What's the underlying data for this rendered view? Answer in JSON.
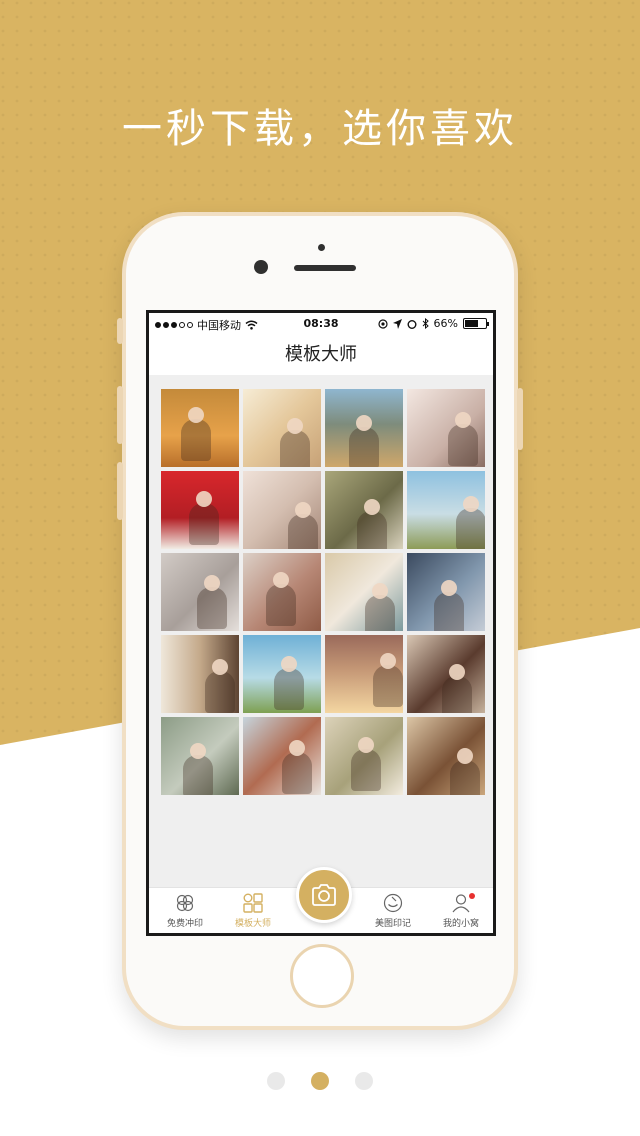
{
  "headline": "一秒下载，选你喜欢",
  "colors": {
    "brand_gold": "#d4b061",
    "background_gold": "#d9b462",
    "phone_rim": "#f1dfc4",
    "badge_red": "#e7302f"
  },
  "status_bar": {
    "carrier": "中国移动",
    "time": "08:38",
    "battery": "66%",
    "battery_level": 0.66,
    "icons": [
      "signal-dots",
      "wifi",
      "location",
      "alarm",
      "bluetooth",
      "battery"
    ]
  },
  "nav": {
    "title": "模板大师"
  },
  "photos": [
    {
      "name": "photo-maple-leaf",
      "bg": "linear-gradient(180deg,#c48a3a,#e7a24a 60%,#b86f2a)"
    },
    {
      "name": "photo-sunlight-hair",
      "bg": "linear-gradient(135deg,#f6ecd5,#e4c79a 50%,#c7a277)"
    },
    {
      "name": "photo-mountain-field",
      "bg": "linear-gradient(180deg,#8fb6cf,#7e8c7c 45%,#cfa76a)"
    },
    {
      "name": "photo-girl-flower",
      "bg": "linear-gradient(135deg,#f3e7e1,#c9b0a6 60%,#8a6d63)"
    },
    {
      "name": "photo-telephone-booth",
      "bg": "linear-gradient(180deg,#d8272c,#b31e24 60%,#f1ece4)"
    },
    {
      "name": "photo-girl-lying",
      "bg": "linear-gradient(135deg,#efe1d8,#d4beb0 50%,#a58777)"
    },
    {
      "name": "photo-grass-lying",
      "bg": "linear-gradient(135deg,#a9a67a,#6c6a48 55%,#d9d2bd)"
    },
    {
      "name": "photo-jump-field",
      "bg": "linear-gradient(180deg,#8ec1e0,#c9dde4 55%,#8d9b57)"
    },
    {
      "name": "photo-veil",
      "bg": "linear-gradient(135deg,#d2cbc6,#a89f9a 55%,#e5dfdb)"
    },
    {
      "name": "photo-flower-crown",
      "bg": "linear-gradient(135deg,#dcd0c7,#b78775 55%,#8f5b46)"
    },
    {
      "name": "photo-fan",
      "bg": "linear-gradient(135deg,#d9c9a8,#f0e8dc 50%,#7c9a9d)"
    },
    {
      "name": "photo-dark-hair",
      "bg": "linear-gradient(135deg,#3b4a5f,#8197ad 55%,#c5ccd6)"
    },
    {
      "name": "photo-window",
      "bg": "linear-gradient(90deg,#efe7da,#c4a98a 50%,#5d4433)"
    },
    {
      "name": "photo-windmill",
      "bg": "linear-gradient(180deg,#6fb0d6,#b7dbe6 55%,#7ea052)"
    },
    {
      "name": "photo-sunset-tree",
      "bg": "linear-gradient(180deg,#9a6a5b,#c59876 45%,#f4d6a1)"
    },
    {
      "name": "photo-long-hair",
      "bg": "linear-gradient(135deg,#d9c7b4,#5a3b2e 55%,#c6b29d)"
    },
    {
      "name": "photo-forest-girl",
      "bg": "linear-gradient(135deg,#8c9c86,#c4cbbd 55%,#5f6a52)"
    },
    {
      "name": "photo-back-hair",
      "bg": "linear-gradient(135deg,#c6d4dc,#b16b51 50%,#e9e4de)"
    },
    {
      "name": "photo-flowers-field",
      "bg": "linear-gradient(135deg,#dcd2b9,#a7a17a 55%,#f3ecdf)"
    },
    {
      "name": "photo-braid",
      "bg": "linear-gradient(135deg,#dcc6a6,#7a5236 55%,#caa67c)"
    }
  ],
  "tabs": [
    {
      "label": "免费冲印",
      "icon": "clover-icon"
    },
    {
      "label": "模板大师",
      "icon": "grid-icon"
    },
    {
      "label": "美图印记",
      "icon": "smile-icon"
    },
    {
      "label": "我的小窝",
      "icon": "person-icon"
    }
  ],
  "camera_button": {
    "icon": "camera-icon"
  },
  "pager": {
    "count": 3,
    "active": 1
  }
}
